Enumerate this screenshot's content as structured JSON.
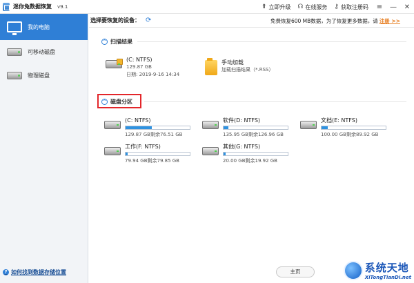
{
  "titlebar": {
    "title": "迷你兔数据恢复",
    "version": "v9.1",
    "links": [
      {
        "icon": "upgrade-icon",
        "glyph": "⬆",
        "label": "立即升级"
      },
      {
        "icon": "headset-icon",
        "glyph": "☊",
        "label": "在线服务"
      },
      {
        "icon": "key-icon",
        "glyph": "⚷",
        "label": "获取注册码"
      }
    ],
    "controls": [
      "≡",
      "—",
      "✕"
    ]
  },
  "sidebar": {
    "items": [
      {
        "label": "我的电脑",
        "icon": "monitor-icon",
        "active": true
      },
      {
        "label": "可移动磁盘",
        "icon": "disk-icon",
        "active": false
      },
      {
        "label": "物理磁盘",
        "icon": "disk-icon",
        "active": false
      }
    ],
    "help_label": "如何找到数据存储位置"
  },
  "devicebar": {
    "label": "选择要恢复的设备：",
    "promo_text": "免费恢复600 MB数据，为了恢复更多数据，请",
    "promo_link": "注册 >>"
  },
  "scan_results": {
    "title": "扫描结果",
    "items": [
      {
        "name": "(C: NTFS)",
        "size": "129.87 GB",
        "date": "日期: 2019-9-16 14:34"
      },
      {
        "name": "手动加载",
        "sub": "加载扫描结果（*.RSS）"
      }
    ]
  },
  "partitions": {
    "title": "磁盘分区",
    "items": [
      {
        "name": "(C: NTFS)",
        "detail": "129.87 GB剩余76.51 GB",
        "used": 0.41
      },
      {
        "name": "软件(D: NTFS)",
        "detail": "135.95 GB剩余126.96 GB",
        "used": 0.07
      },
      {
        "name": "文档(E: NTFS)",
        "detail": "100.00 GB剩余89.92 GB",
        "used": 0.1
      },
      {
        "name": "工作(F: NTFS)",
        "detail": "79.94 GB剩余79.85 GB",
        "used": 0.01
      },
      {
        "name": "其他(G: NTFS)",
        "detail": "20.00 GB剩余19.92 GB",
        "used": 0.01
      }
    ]
  },
  "footer": {
    "home_label": "主页"
  },
  "watermark": {
    "cn": "系统天地",
    "en": "XiTongTianDi.net"
  },
  "colors": {
    "accent": "#2f7fd6",
    "bar_fill": "#2f92e0",
    "highlight_box": "#e3262a",
    "promo_link": "#e67e22"
  }
}
